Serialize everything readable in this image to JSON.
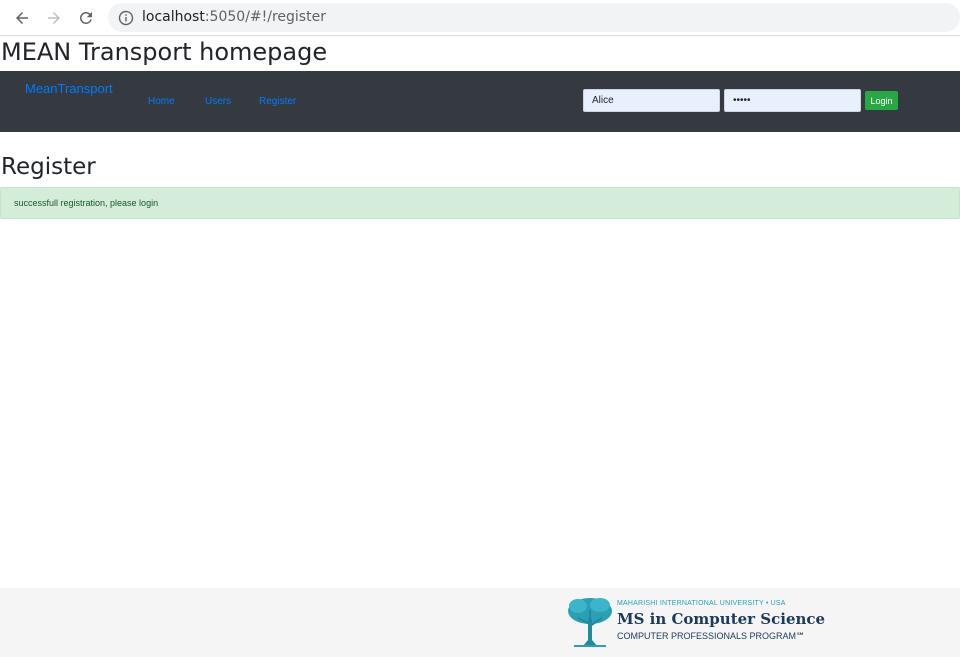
{
  "browser": {
    "url_host": "localhost",
    "url_path": ":5050/#!/register"
  },
  "page": {
    "title": "MEAN Transport homepage"
  },
  "navbar": {
    "brand": "MeanTransport",
    "links": [
      "Home",
      "Users",
      "Register"
    ],
    "username_value": "Alice",
    "password_value": "12345",
    "login_label": "Login"
  },
  "main": {
    "heading": "Register",
    "alert_text": "successfull registration, please login"
  },
  "footer": {
    "logo_top": "MAHARISHI INTERNATIONAL UNIVERSITY • USA",
    "logo_main": "MS in Computer Science",
    "logo_sub": "COMPUTER PROFESSIONALS PROGRAM℠"
  },
  "colors": {
    "navbar_bg": "#343a40",
    "link": "#007bff",
    "success_button": "#28a745",
    "alert_bg": "#d4edda",
    "alert_text": "#155724",
    "logo_teal": "#2a9fb6",
    "logo_navy": "#1b3b5c"
  },
  "icons": [
    "back-arrow-icon",
    "forward-arrow-icon",
    "reload-icon",
    "info-icon",
    "tree-logo-icon"
  ]
}
